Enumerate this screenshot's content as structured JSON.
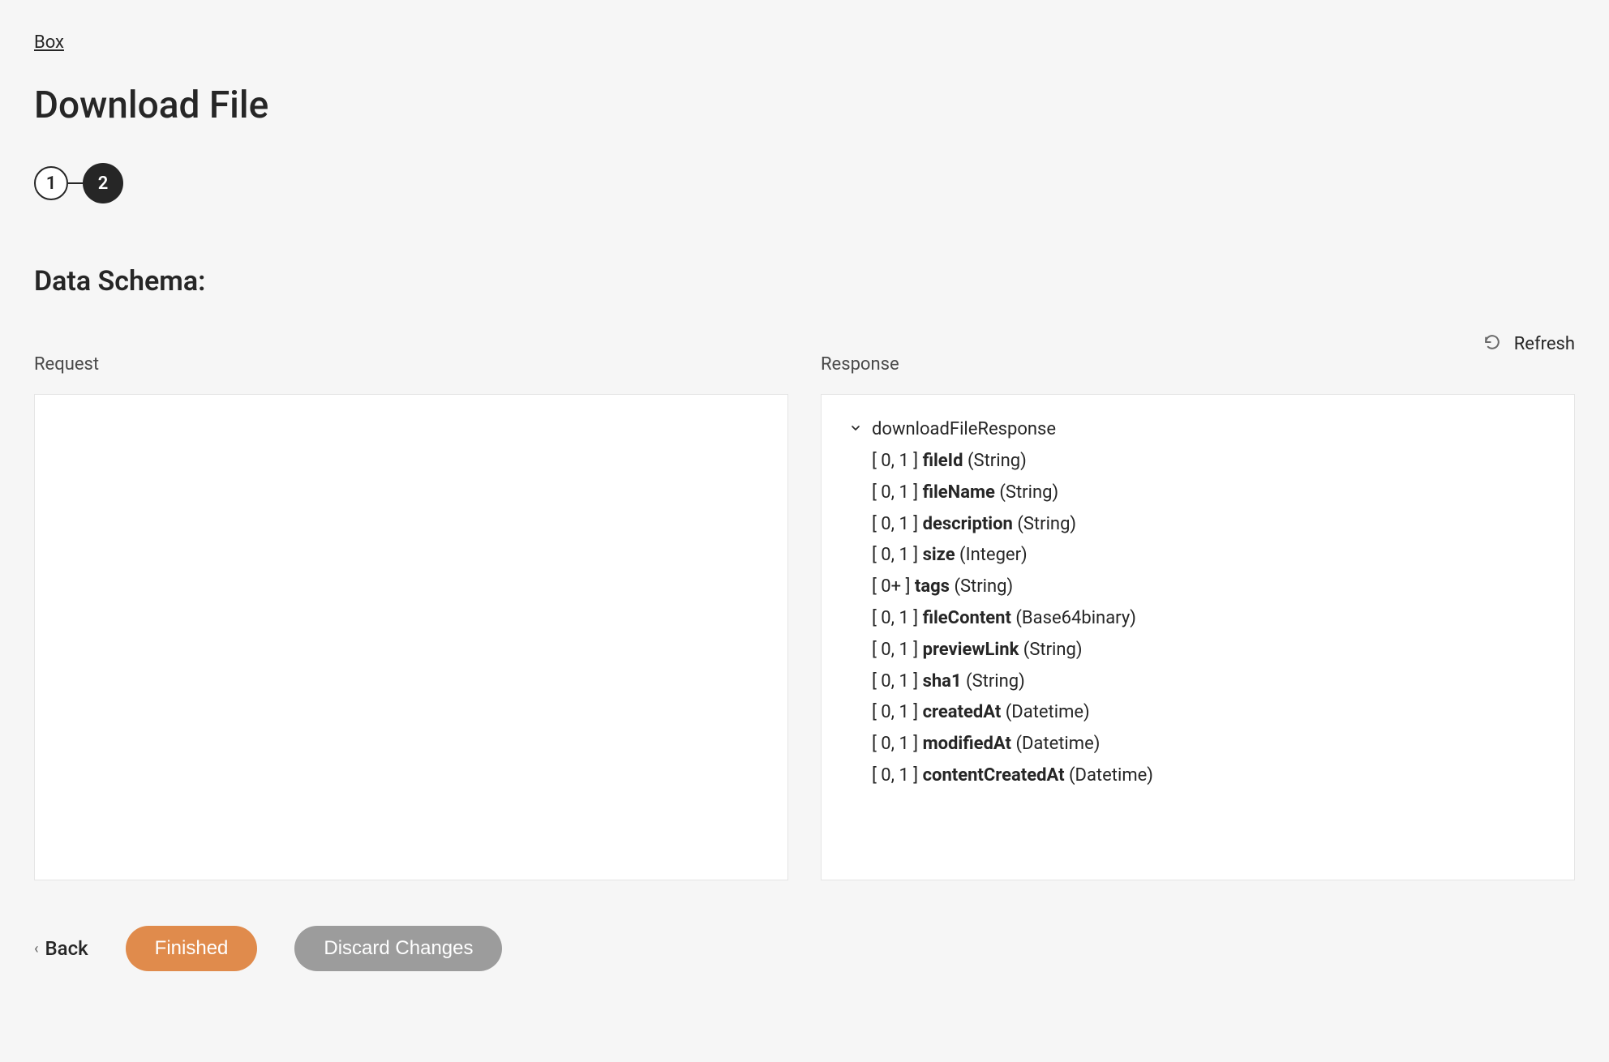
{
  "breadcrumb": {
    "label": "Box"
  },
  "page": {
    "title": "Download File"
  },
  "stepper": {
    "step1": "1",
    "step2": "2"
  },
  "section": {
    "title": "Data Schema:"
  },
  "refresh": {
    "label": "Refresh"
  },
  "columns": {
    "request_label": "Request",
    "response_label": "Response"
  },
  "response": {
    "root_label": "downloadFileResponse",
    "fields": [
      {
        "card": "[ 0, 1 ]",
        "name": "fileId",
        "type": "(String)"
      },
      {
        "card": "[ 0, 1 ]",
        "name": "fileName",
        "type": "(String)"
      },
      {
        "card": "[ 0, 1 ]",
        "name": "description",
        "type": "(String)"
      },
      {
        "card": "[ 0, 1 ]",
        "name": "size",
        "type": "(Integer)"
      },
      {
        "card": "[ 0+ ]",
        "name": "tags",
        "type": "(String)"
      },
      {
        "card": "[ 0, 1 ]",
        "name": "fileContent",
        "type": "(Base64binary)"
      },
      {
        "card": "[ 0, 1 ]",
        "name": "previewLink",
        "type": "(String)"
      },
      {
        "card": "[ 0, 1 ]",
        "name": "sha1",
        "type": "(String)"
      },
      {
        "card": "[ 0, 1 ]",
        "name": "createdAt",
        "type": "(Datetime)"
      },
      {
        "card": "[ 0, 1 ]",
        "name": "modifiedAt",
        "type": "(Datetime)"
      },
      {
        "card": "[ 0, 1 ]",
        "name": "contentCreatedAt",
        "type": "(Datetime)"
      }
    ]
  },
  "footer": {
    "back_label": "Back",
    "finished_label": "Finished",
    "discard_label": "Discard Changes"
  }
}
